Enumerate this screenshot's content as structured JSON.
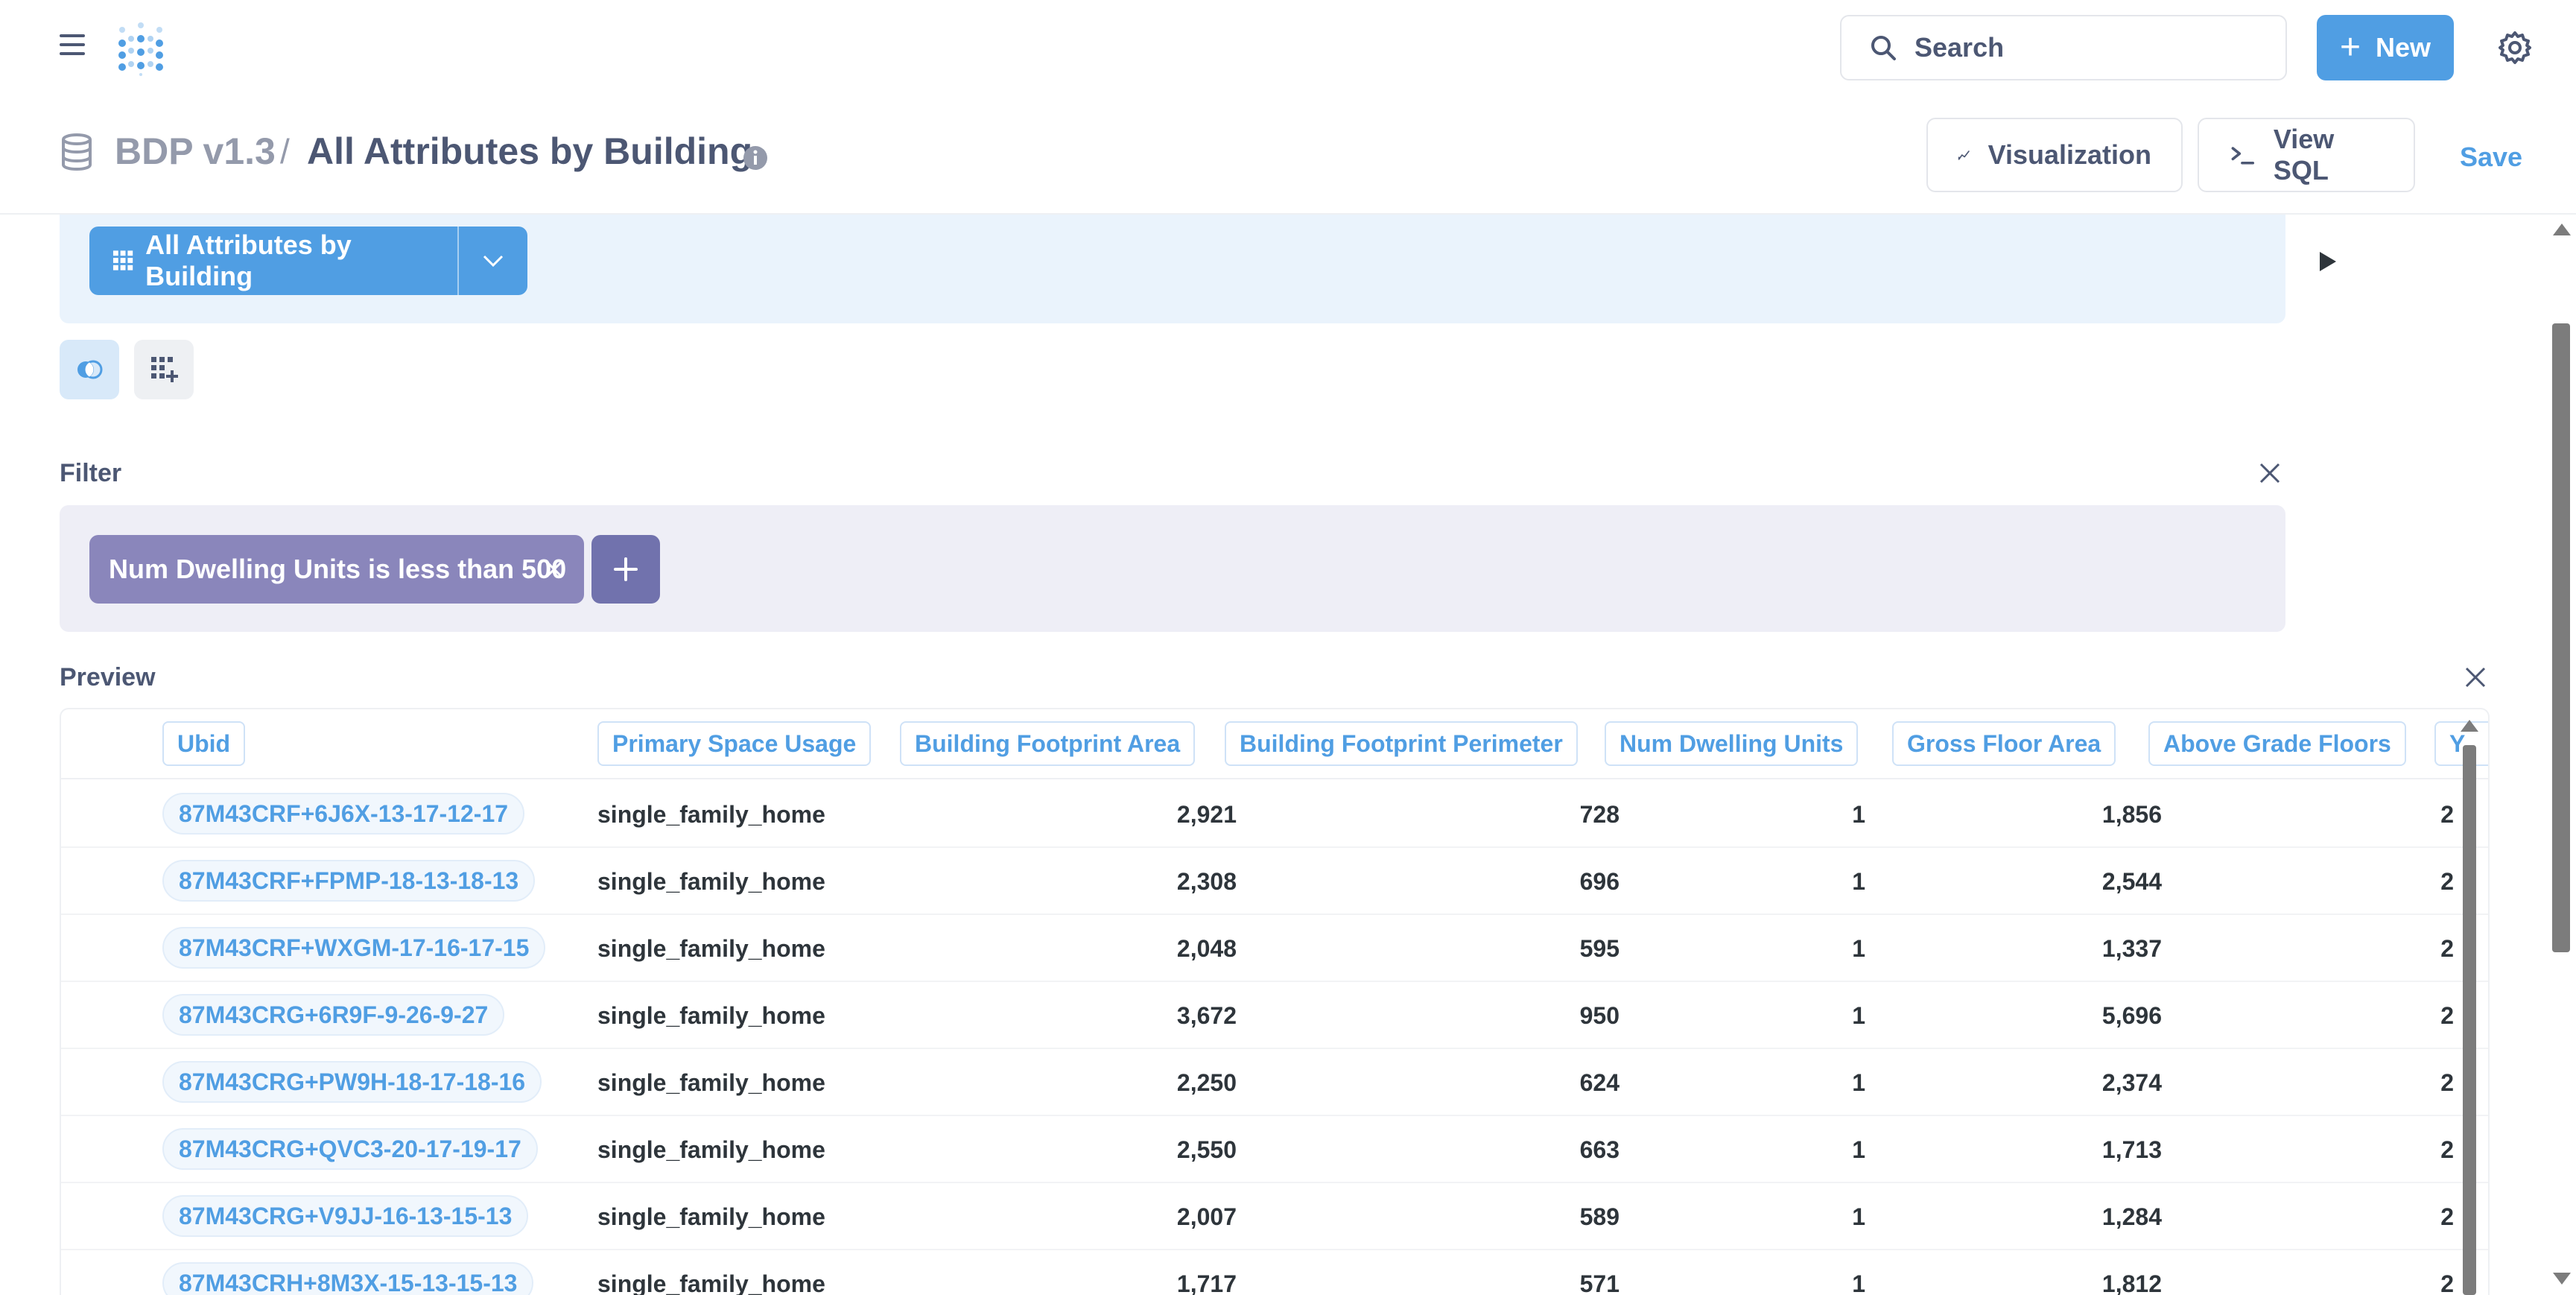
{
  "nav": {
    "search_placeholder": "Search",
    "new_label": "New",
    "icons": [
      "hamburger-icon",
      "logo",
      "search-icon",
      "plus-icon",
      "gear-icon"
    ]
  },
  "header": {
    "database": "BDP v1.3",
    "separator": "/",
    "title": "All Attributes by Building",
    "visualization_label": "Visualization",
    "view_sql_label": "View SQL",
    "save_label": "Save"
  },
  "data_step": {
    "source": "All Attributes by Building"
  },
  "filter": {
    "label": "Filter",
    "pill": "Num Dwelling Units is less than 500"
  },
  "preview": {
    "label": "Preview",
    "columns": [
      "Ubid",
      "Primary Space Usage",
      "Building Footprint Area",
      "Building Footprint Perimeter",
      "Num Dwelling Units",
      "Gross Floor Area",
      "Above Grade Floors",
      "Y"
    ],
    "rows": [
      [
        "87M43CRF+6J6X-13-17-12-17",
        "single_family_home",
        "2,921",
        "728",
        "1",
        "1,856",
        "2"
      ],
      [
        "87M43CRF+FPMP-18-13-18-13",
        "single_family_home",
        "2,308",
        "696",
        "1",
        "2,544",
        "2"
      ],
      [
        "87M43CRF+WXGM-17-16-17-15",
        "single_family_home",
        "2,048",
        "595",
        "1",
        "1,337",
        "2"
      ],
      [
        "87M43CRG+6R9F-9-26-9-27",
        "single_family_home",
        "3,672",
        "950",
        "1",
        "5,696",
        "2"
      ],
      [
        "87M43CRG+PW9H-18-17-18-16",
        "single_family_home",
        "2,250",
        "624",
        "1",
        "2,374",
        "2"
      ],
      [
        "87M43CRG+QVC3-20-17-19-17",
        "single_family_home",
        "2,550",
        "663",
        "1",
        "1,713",
        "2"
      ],
      [
        "87M43CRG+V9JJ-16-13-15-13",
        "single_family_home",
        "2,007",
        "589",
        "1",
        "1,284",
        "2"
      ],
      [
        "87M43CRH+8M3X-15-13-15-13",
        "single_family_home",
        "1,717",
        "571",
        "1",
        "1,812",
        "2"
      ]
    ]
  },
  "colors": {
    "brand": "#509ee3",
    "filter": "#8a86bb",
    "filter_add": "#7172ad",
    "text": "#4c5773"
  }
}
